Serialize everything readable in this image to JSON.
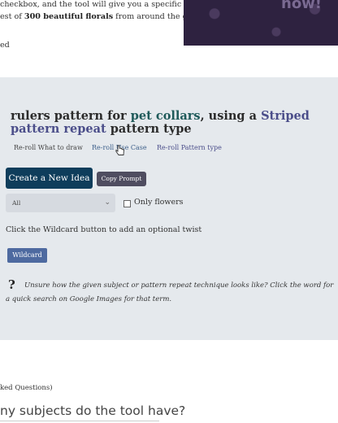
{
  "intro": {
    "line1": "checkbox, and the tool will give you a specific",
    "line2_prefix": "est of ",
    "line2_bold": "300 beautiful florals",
    "line2_suffix": " from around the globe.",
    "line3": "ed"
  },
  "promo": {
    "text": "now!"
  },
  "prompt": {
    "part1": "rulers pattern for ",
    "subject": "pet collars",
    "part2": ", using a ",
    "repeat": "Striped pattern repeat",
    "part3": " pattern type"
  },
  "reroll": {
    "what": "Re-roll What to draw",
    "case": "Re-roll Use Case",
    "repeat": "Re-roll Pattern type"
  },
  "buttons": {
    "create": "Create a New Idea",
    "copy": "Copy Prompt",
    "wildcard": "Wildcard"
  },
  "filter": {
    "select_value": "All",
    "checkbox_label": "Only flowers"
  },
  "wildcard_hint": "Click the Wildcard button to add an optional twist",
  "help": {
    "icon": "question-icon",
    "symbol": "?",
    "text": "Unsure how the given subject or pattern repeat technique looks like? Click the word for a quick search on Google Images for that term."
  },
  "faq": {
    "subheading": "ked Questions)",
    "question": "ny subjects do the tool have?"
  },
  "colors": {
    "panel_bg": "#e5e9ed",
    "create_btn": "#0e3d5b",
    "copy_btn": "#4f4d60",
    "wildcard_btn": "#4e6aa0",
    "subject_accent": "#1f5a5a",
    "repeat_accent": "#4b4e8a"
  }
}
